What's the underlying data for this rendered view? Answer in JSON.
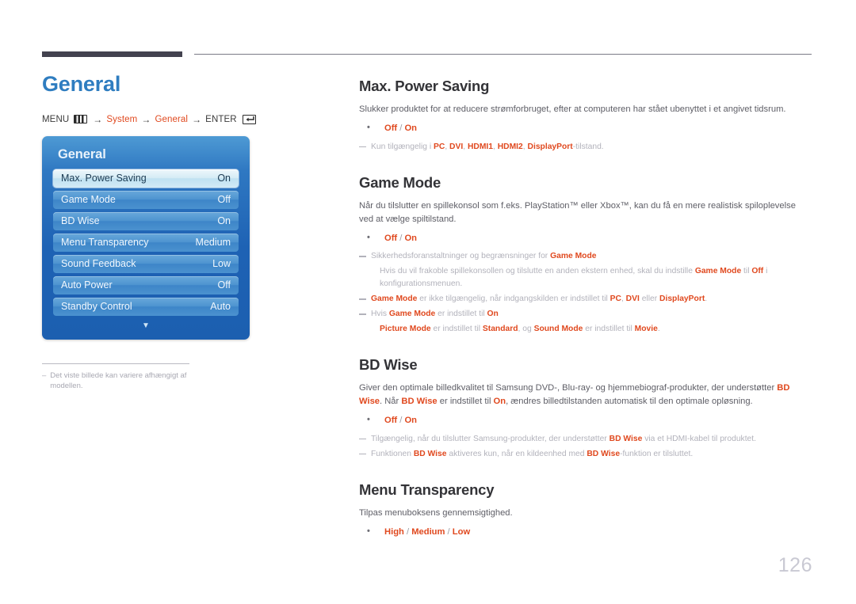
{
  "chapter": {
    "title": "General"
  },
  "breadcrumb": {
    "menu_label": "MENU",
    "menu_icon": "menu-bars-icon",
    "arrow": "→",
    "step1": "System",
    "step2": "General",
    "enter_label": "ENTER",
    "enter_icon": "enter-key-icon"
  },
  "osd": {
    "title": "General",
    "rows": [
      {
        "label": "Max. Power Saving",
        "value": "On",
        "selected": true
      },
      {
        "label": "Game Mode",
        "value": "Off",
        "selected": false
      },
      {
        "label": "BD Wise",
        "value": "On",
        "selected": false
      },
      {
        "label": "Menu Transparency",
        "value": "Medium",
        "selected": false
      },
      {
        "label": "Sound Feedback",
        "value": "Low",
        "selected": false
      },
      {
        "label": "Auto Power",
        "value": "Off",
        "selected": false
      },
      {
        "label": "Standby Control",
        "value": "Auto",
        "selected": false
      }
    ],
    "scroll_down_icon": "chevron-down-icon"
  },
  "left_footnote": {
    "dash": "–",
    "text": "Det viste billede kan variere afhængigt af modellen."
  },
  "sections": [
    {
      "id": "max-power-saving",
      "title": "Max. Power Saving",
      "body": "Slukker produktet for at reducere strømforbruget, efter at computeren har stået ubenyttet i et angivet tidsrum.",
      "options": [
        {
          "parts": [
            "Off",
            " / ",
            "On"
          ]
        }
      ],
      "notes": [
        {
          "sub": false,
          "segments": [
            {
              "t": "Kun tilgængelig i ",
              "red": false
            },
            {
              "t": "PC",
              "red": true
            },
            {
              "t": ", ",
              "red": false
            },
            {
              "t": "DVI",
              "red": true
            },
            {
              "t": ", ",
              "red": false
            },
            {
              "t": "HDMI1",
              "red": true
            },
            {
              "t": ", ",
              "red": false
            },
            {
              "t": "HDMI2",
              "red": true
            },
            {
              "t": ", ",
              "red": false
            },
            {
              "t": "DisplayPort",
              "red": true
            },
            {
              "t": "-tilstand.",
              "red": false
            }
          ]
        }
      ]
    },
    {
      "id": "game-mode",
      "title": "Game Mode",
      "body": "Når du tilslutter en spillekonsol som f.eks. PlayStation™ eller Xbox™, kan du få en mere realistisk spiloplevelse ved at vælge spiltilstand.",
      "options": [
        {
          "parts": [
            "Off",
            " / ",
            "On"
          ]
        }
      ],
      "notes": [
        {
          "sub": false,
          "segments": [
            {
              "t": "Sikkerhedsforanstaltninger og begrænsninger for ",
              "red": false
            },
            {
              "t": "Game Mode",
              "red": true
            }
          ]
        },
        {
          "sub": true,
          "segments": [
            {
              "t": "Hvis du vil frakoble spillekonsollen og tilslutte en anden ekstern enhed, skal du indstille ",
              "red": false
            },
            {
              "t": "Game Mode",
              "red": true
            },
            {
              "t": " til ",
              "red": false
            },
            {
              "t": "Off",
              "red": true
            },
            {
              "t": " i konfigurationsmenuen.",
              "red": false
            }
          ]
        },
        {
          "sub": false,
          "segments": [
            {
              "t": "Game Mode",
              "red": true
            },
            {
              "t": " er ikke tilgængelig, når indgangskilden er indstillet til ",
              "red": false
            },
            {
              "t": "PC",
              "red": true
            },
            {
              "t": ", ",
              "red": false
            },
            {
              "t": "DVI",
              "red": true
            },
            {
              "t": " eller ",
              "red": false
            },
            {
              "t": "DisplayPort",
              "red": true
            },
            {
              "t": ".",
              "red": false
            }
          ]
        },
        {
          "sub": false,
          "segments": [
            {
              "t": "Hvis ",
              "red": false
            },
            {
              "t": "Game Mode",
              "red": true
            },
            {
              "t": " er indstillet til ",
              "red": false
            },
            {
              "t": "On",
              "red": true
            }
          ]
        },
        {
          "sub": true,
          "segments": [
            {
              "t": "Picture Mode",
              "red": true
            },
            {
              "t": " er indstillet til ",
              "red": false
            },
            {
              "t": "Standard",
              "red": true
            },
            {
              "t": ", og ",
              "red": false
            },
            {
              "t": "Sound Mode",
              "red": true
            },
            {
              "t": " er indstillet til ",
              "red": false
            },
            {
              "t": "Movie",
              "red": true
            },
            {
              "t": ".",
              "red": false
            }
          ]
        }
      ]
    },
    {
      "id": "bd-wise",
      "title": "BD Wise",
      "body_segments": [
        {
          "t": "Giver den optimale billedkvalitet til Samsung DVD-, Blu-ray- og hjemmebiograf-produkter, der understøtter ",
          "red": false
        },
        {
          "t": "BD Wise",
          "red": true
        },
        {
          "t": ". Når ",
          "red": false
        },
        {
          "t": "BD Wise",
          "red": true
        },
        {
          "t": " er indstillet til ",
          "red": false
        },
        {
          "t": "On",
          "red": true
        },
        {
          "t": ", ændres billedtilstanden automatisk til den optimale opløsning.",
          "red": false
        }
      ],
      "options": [
        {
          "parts": [
            "Off",
            " / ",
            "On"
          ]
        }
      ],
      "notes": [
        {
          "sub": false,
          "segments": [
            {
              "t": "Tilgængelig, når du tilslutter Samsung-produkter, der understøtter ",
              "red": false
            },
            {
              "t": "BD Wise",
              "red": true
            },
            {
              "t": " via et HDMI-kabel til produktet.",
              "red": false
            }
          ]
        },
        {
          "sub": false,
          "segments": [
            {
              "t": "Funktionen ",
              "red": false
            },
            {
              "t": "BD Wise",
              "red": true
            },
            {
              "t": " aktiveres kun, når en kildeenhed med ",
              "red": false
            },
            {
              "t": "BD Wise",
              "red": true
            },
            {
              "t": "-funktion er tilsluttet.",
              "red": false
            }
          ]
        }
      ]
    },
    {
      "id": "menu-transparency",
      "title": "Menu Transparency",
      "body": "Tilpas menuboksens gennemsigtighed.",
      "options": [
        {
          "parts": [
            "High",
            " / ",
            "Medium",
            " / ",
            "Low"
          ]
        }
      ],
      "notes": []
    }
  ],
  "page_number": "126",
  "colors": {
    "chapter_title": "#2f7dc0",
    "accent_red": "#e0491f",
    "heading": "#333337",
    "body_text": "#5e5e66",
    "note_text": "#b2b2bb",
    "osd_blue": "#1e62b4",
    "rule_dark": "#43424f",
    "page_number": "#c9c9d3"
  }
}
